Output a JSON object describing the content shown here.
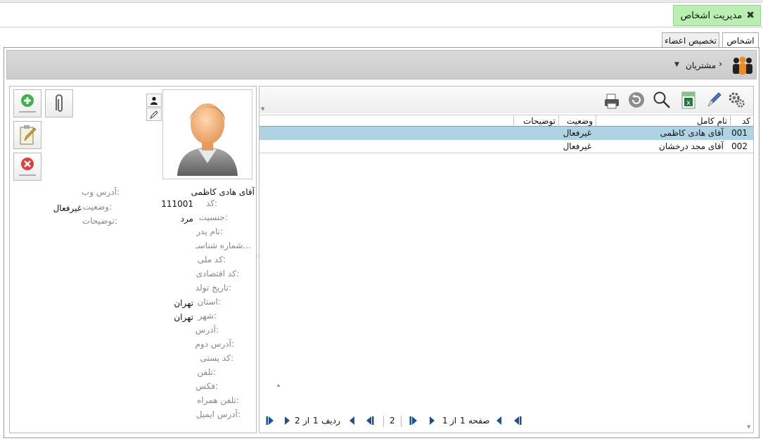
{
  "window": {
    "title": "مدیریت اشخاص",
    "close_icon": "close-icon"
  },
  "tabs": [
    {
      "label": "اشخاص",
      "active": true
    },
    {
      "label": "تخصیص اعضاء",
      "active": false
    }
  ],
  "breadcrumb": {
    "icon": "customers-group-icon",
    "label": "مشتریان"
  },
  "toolbar": {
    "icons": [
      "settings-icon",
      "edit-icon",
      "excel-export-icon",
      "search-icon",
      "refresh-icon",
      "print-icon"
    ]
  },
  "grid": {
    "columns": [
      "کد",
      "نام کامل",
      "وضعیت",
      "توضیحات"
    ],
    "rows": [
      {
        "code": "001",
        "name": "آقای هادی کاظمی",
        "status": "غیرفعال",
        "notes": "",
        "selected": true
      },
      {
        "code": "002",
        "name": "آقای مجد درخشان",
        "status": "غیرفعال",
        "notes": "",
        "selected": false
      }
    ]
  },
  "pager": {
    "page_label": "صفحه",
    "page": "1",
    "of_label": "از",
    "page_total": "1",
    "page_size": "2",
    "row_label": "ردیف",
    "row": "1",
    "row_total": "2"
  },
  "detail": {
    "name": "آقای هادی کاظمی",
    "fields_right": [
      {
        "label": "کد:",
        "value": "111001"
      },
      {
        "label": "جنسیت:",
        "value": "مرد"
      },
      {
        "label": "نام پدر:",
        "value": ""
      },
      {
        "label": "شماره شناسـ...",
        "value": ""
      },
      {
        "label": "کد ملی:",
        "value": ""
      },
      {
        "label": "کد اقتصادی:",
        "value": ""
      },
      {
        "label": "تاریخ تولد:",
        "value": ""
      },
      {
        "label": "استان:",
        "value": "تهران"
      },
      {
        "label": "شهر:",
        "value": "تهران"
      },
      {
        "label": "آدرس:",
        "value": ""
      },
      {
        "label": "آدرس دوم:",
        "value": ""
      },
      {
        "label": "کد پستی:",
        "value": ""
      },
      {
        "label": "تلفن:",
        "value": ""
      },
      {
        "label": "فکس:",
        "value": ""
      },
      {
        "label": "تلفن همراه:",
        "value": ""
      },
      {
        "label": "آدرس ایمیل:",
        "value": ""
      }
    ],
    "fields_left": [
      {
        "label": "آدرس وب:",
        "value": ""
      },
      {
        "label": "وضعیت:",
        "value": "غیرفعال"
      },
      {
        "label": "توضیحات:",
        "value": ""
      }
    ]
  },
  "colors": {
    "title_bg": "#b9f0b2",
    "selected_row": "#aed4e4",
    "add_green": "#3bb54a",
    "delete_red": "#e0403a"
  }
}
